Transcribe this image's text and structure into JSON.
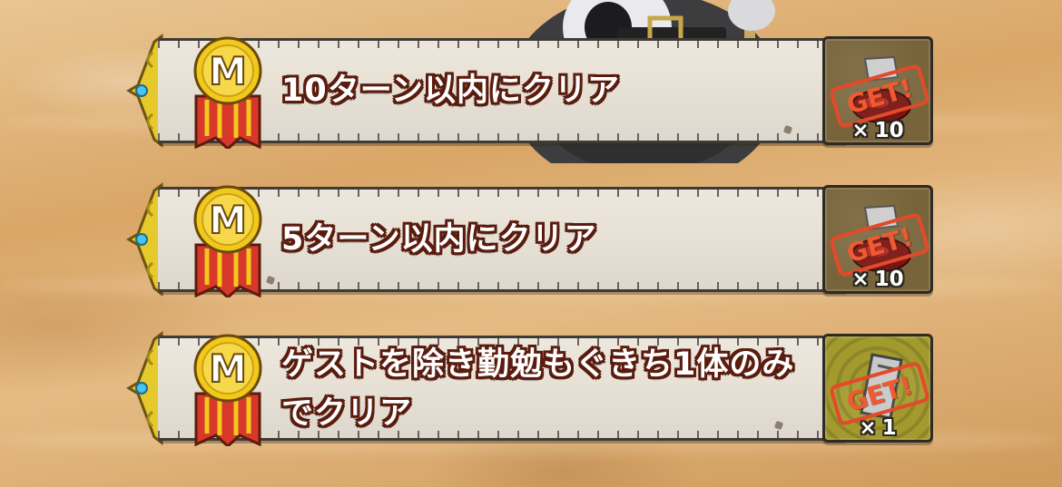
{
  "missions": [
    {
      "medal_letter": "M",
      "text": "10ターン以内にクリア",
      "reward": {
        "stamp": "GET!",
        "times_symbol": "×",
        "count": "10",
        "item_icon": "red-stone-icon",
        "frame_color": "#78643a"
      }
    },
    {
      "medal_letter": "M",
      "text": "5ターン以内にクリア",
      "reward": {
        "stamp": "GET!",
        "times_symbol": "×",
        "count": "10",
        "item_icon": "red-stone-icon",
        "frame_color": "#78643a"
      }
    },
    {
      "medal_letter": "M",
      "text": "ゲストを除き勤勉もぐきち1体のみでクリア",
      "reward": {
        "stamp": "GET!",
        "times_symbol": "×",
        "count": "1",
        "item_icon": "ticket-icon",
        "frame_color": "#a39a2e"
      }
    }
  ],
  "colors": {
    "text_outline": "#5a1c0e",
    "stamp": "#e4492a",
    "medal_gold": "#f2c81c",
    "ribbon_red": "#d8382a"
  }
}
